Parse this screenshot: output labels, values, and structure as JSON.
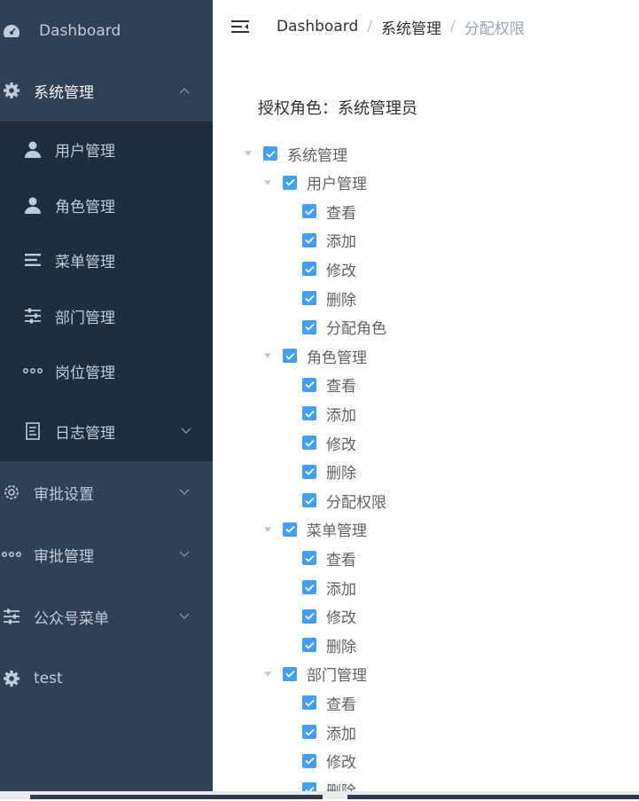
{
  "sidebar": {
    "dashboard": "Dashboard",
    "system": "系统管理",
    "sub": [
      {
        "label": "用户管理",
        "icon": "user-icon"
      },
      {
        "label": "角色管理",
        "icon": "user-icon"
      },
      {
        "label": "菜单管理",
        "icon": "list-icon"
      },
      {
        "label": "部门管理",
        "icon": "sliders-icon"
      },
      {
        "label": "岗位管理",
        "icon": "more-dots-icon"
      },
      {
        "label": "日志管理",
        "icon": "document-icon"
      }
    ],
    "approval_settings": "审批设置",
    "approval_management": "审批管理",
    "wechat_menu": "公众号菜单",
    "test": "test"
  },
  "header": {
    "breadcrumb": [
      "Dashboard",
      "系统管理",
      "分配权限"
    ],
    "separator": "/"
  },
  "main": {
    "role_label": "授权角色：系统管理员",
    "tree": {
      "root": "系统管理",
      "groups": [
        {
          "label": "用户管理",
          "children": [
            "查看",
            "添加",
            "修改",
            "删除",
            "分配角色"
          ]
        },
        {
          "label": "角色管理",
          "children": [
            "查看",
            "添加",
            "修改",
            "删除",
            "分配权限"
          ]
        },
        {
          "label": "菜单管理",
          "children": [
            "查看",
            "添加",
            "修改",
            "删除"
          ]
        },
        {
          "label": "部门管理",
          "children": [
            "查看",
            "添加",
            "修改",
            "删除"
          ]
        }
      ]
    }
  },
  "colors": {
    "sidebar_bg": "#304156",
    "submenu_bg": "#1f2d3d",
    "accent": "#409eff"
  }
}
